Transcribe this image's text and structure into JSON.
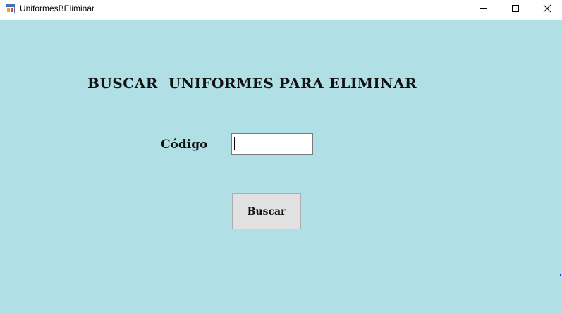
{
  "window": {
    "title": "UniformesBEliminar",
    "background": "#b0dfe5",
    "controls": {
      "minimize_icon": "minimize-icon",
      "maximize_icon": "maximize-icon",
      "close_icon": "close-icon"
    }
  },
  "form": {
    "heading": "BUSCAR  UNIFORMES PARA ELIMINAR",
    "codigo_label": "Código",
    "codigo_value": "",
    "buscar_label": "Buscar"
  }
}
